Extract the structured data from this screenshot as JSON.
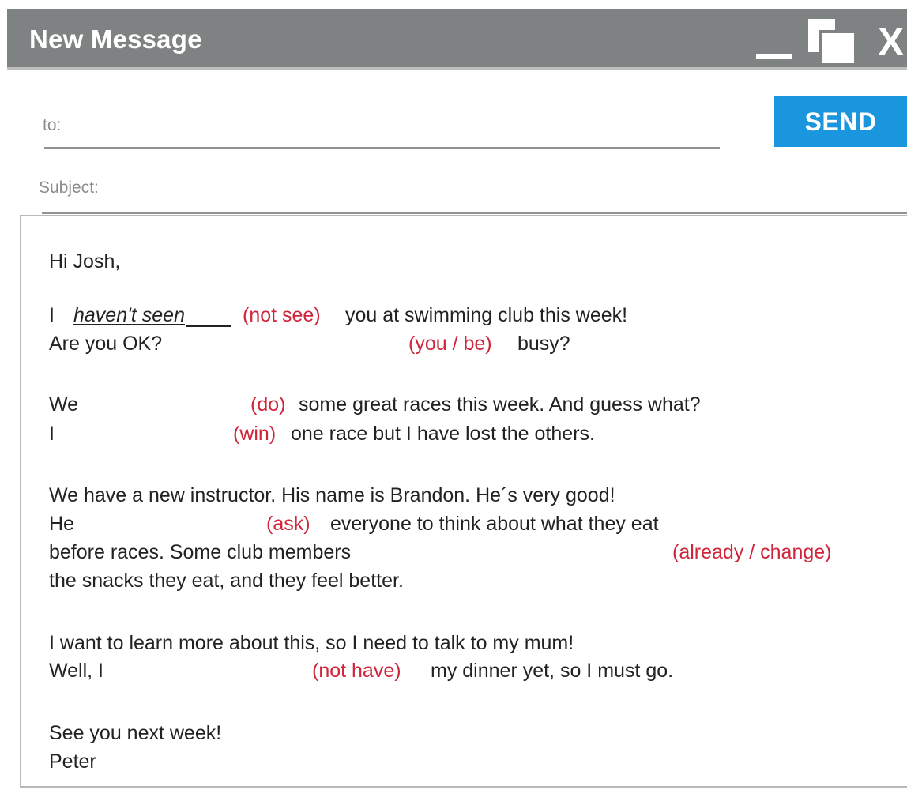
{
  "window": {
    "title": "New Message",
    "controls": {
      "minimize": "minimize-icon",
      "restore": "restore-icon",
      "close": "X"
    }
  },
  "fields": {
    "to_label": "to:",
    "subject_label": "Subject:"
  },
  "toolbar": {
    "send_label": "SEND"
  },
  "message": {
    "greeting": "Hi Josh,",
    "p1_i": "I",
    "p1_answer": "haven't seen",
    "p1_hint": "(not see)",
    "p1_rest": "you at swimming club this week!",
    "p2_text": "Are you OK?",
    "p2_hint": "(you / be)",
    "p2_rest": "busy?",
    "p3_we": "We",
    "p3_hint": "(do)",
    "p3_rest": "some great races this week. And guess what?",
    "p4_i": "I",
    "p4_hint": "(win)",
    "p4_rest": "one race but I have lost the others.",
    "p5_text": "We have a new instructor. His name is Brandon. He´s very good!",
    "p6_he": "He",
    "p6_hint": "(ask)",
    "p6_rest": "everyone to think about what they eat",
    "p7_text": "before races.  Some club members",
    "p7_hint": "(already / change)",
    "p8_text": "the snacks they eat, and they feel better.",
    "p9_text": "I want to learn more about this, so I need to talk to my mum!",
    "p10_text": "Well, I",
    "p10_hint": "(not have)",
    "p10_rest": "my dinner yet, so I must go.",
    "p11_text": "See you next week!",
    "signature": "Peter"
  },
  "colors": {
    "titlebar": "#7f8282",
    "send_button": "#1a96de",
    "hint": "#d0253a"
  }
}
